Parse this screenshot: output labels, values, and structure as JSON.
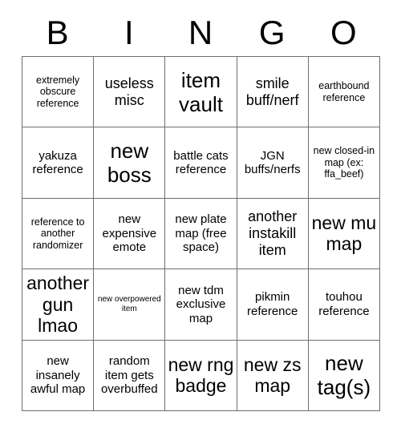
{
  "card": {
    "title": "BINGO",
    "header_letters": [
      "B",
      "I",
      "N",
      "G",
      "O"
    ],
    "columns": 5,
    "rows": 5,
    "border_color": "#6e6e6e",
    "background_color": "#ffffff",
    "text_color": "#000000",
    "free_space_label": "new plate map (free space)",
    "cells": [
      {
        "text": "extremely obscure reference",
        "size": "sm",
        "row": 1,
        "col": 1
      },
      {
        "text": "useless misc",
        "size": "lg",
        "row": 1,
        "col": 2
      },
      {
        "text": "item vault",
        "size": "xxl",
        "row": 1,
        "col": 3
      },
      {
        "text": "smile buff/nerf",
        "size": "lg",
        "row": 1,
        "col": 4
      },
      {
        "text": "earthbound reference",
        "size": "sm",
        "row": 1,
        "col": 5
      },
      {
        "text": "yakuza reference",
        "size": "md",
        "row": 2,
        "col": 1
      },
      {
        "text": "new boss",
        "size": "xxl",
        "row": 2,
        "col": 2
      },
      {
        "text": "battle cats reference",
        "size": "md",
        "row": 2,
        "col": 3
      },
      {
        "text": "JGN buffs/nerfs",
        "size": "md",
        "row": 2,
        "col": 4
      },
      {
        "text": "new closed-in map (ex: ffa_beef)",
        "size": "sm",
        "row": 2,
        "col": 5
      },
      {
        "text": "reference to another randomizer",
        "size": "sm",
        "row": 3,
        "col": 1
      },
      {
        "text": "new expensive emote",
        "size": "md",
        "row": 3,
        "col": 2
      },
      {
        "text": "new plate map (free space)",
        "size": "md",
        "row": 3,
        "col": 3
      },
      {
        "text": "another instakill item",
        "size": "lg",
        "row": 3,
        "col": 4
      },
      {
        "text": "new mu map",
        "size": "xl",
        "row": 3,
        "col": 5
      },
      {
        "text": "another gun lmao",
        "size": "xl",
        "row": 4,
        "col": 1
      },
      {
        "text": "new overpowered item",
        "size": "xs",
        "row": 4,
        "col": 2
      },
      {
        "text": "new tdm exclusive map",
        "size": "md",
        "row": 4,
        "col": 3
      },
      {
        "text": "pikmin reference",
        "size": "md",
        "row": 4,
        "col": 4
      },
      {
        "text": "touhou reference",
        "size": "md",
        "row": 4,
        "col": 5
      },
      {
        "text": "new insanely awful map",
        "size": "md",
        "row": 5,
        "col": 1
      },
      {
        "text": "random item gets overbuffed",
        "size": "md",
        "row": 5,
        "col": 2
      },
      {
        "text": "new rng badge",
        "size": "xl",
        "row": 5,
        "col": 3
      },
      {
        "text": "new zs map",
        "size": "xl",
        "row": 5,
        "col": 4
      },
      {
        "text": "new tag(s)",
        "size": "xxl",
        "row": 5,
        "col": 5
      }
    ]
  }
}
